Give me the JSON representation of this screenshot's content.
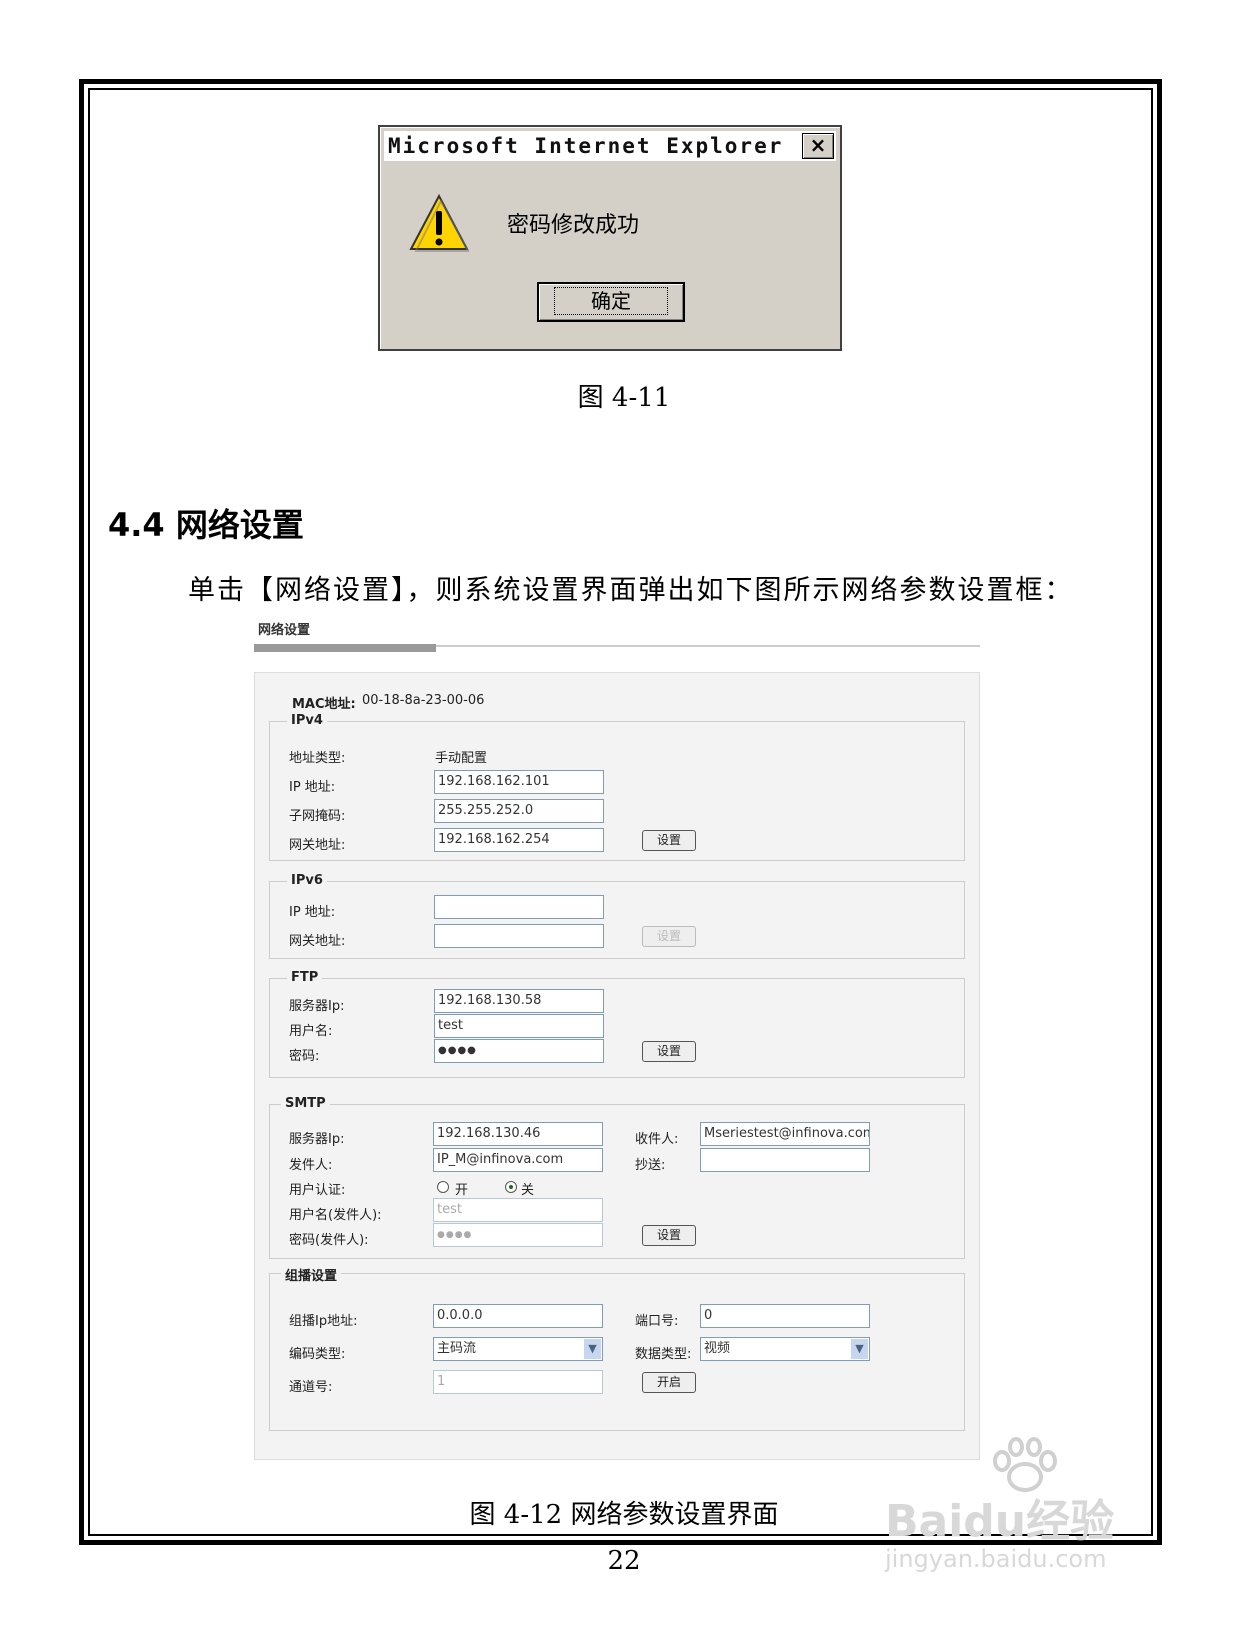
{
  "dialog": {
    "title": "Microsoft Internet Explorer",
    "close": "×",
    "message": "密码修改成功",
    "ok": "确定"
  },
  "fig1": "图 4-11",
  "heading": "4.4  网络设置",
  "intro": "单击【网络设置】，则系统设置界面弹出如下图所示网络参数设置框：",
  "net": {
    "title": "网络设置",
    "mac_label": "MAC地址:",
    "mac_value": "00-18-8a-23-00-06",
    "ipv4": {
      "title": "IPv4",
      "addr_type_label": "地址类型:",
      "addr_type_value": "手动配置",
      "ip_label": "IP 地址:",
      "ip_value": "192.168.162.101",
      "mask_label": "子网掩码:",
      "mask_value": "255.255.252.0",
      "gw_label": "网关地址:",
      "gw_value": "192.168.162.254",
      "set": "设置"
    },
    "ipv6": {
      "title": "IPv6",
      "ip_label": "IP 地址:",
      "ip_value": "",
      "gw_label": "网关地址:",
      "gw_value": "",
      "set": "设置"
    },
    "ftp": {
      "title": "FTP",
      "server_label": "服务器Ip:",
      "server_value": "192.168.130.58",
      "user_label": "用户名:",
      "user_value": "test",
      "pwd_label": "密码:",
      "pwd_value": "●●●●",
      "set": "设置"
    },
    "smtp": {
      "title": "SMTP",
      "server_label": "服务器Ip:",
      "server_value": "192.168.130.46",
      "receiver_label": "收件人:",
      "receiver_value": "Mseriestest@infinova.com",
      "sender_label": "发件人:",
      "sender_value": "IP_M@infinova.com",
      "cc_label": "抄送:",
      "cc_value": "",
      "auth_label": "用户认证:",
      "auth_on": "开",
      "auth_off": "关",
      "user_label": "用户名(发件人):",
      "user_value": "test",
      "pwd_label": "密码(发件人):",
      "pwd_value": "●●●●",
      "set": "设置"
    },
    "multicast": {
      "title": "组播设置",
      "ip_label": "组播Ip地址:",
      "ip_value": "0.0.0.0",
      "port_label": "端口号:",
      "port_value": "0",
      "enc_label": "编码类型:",
      "enc_value": "主码流",
      "data_label": "数据类型:",
      "data_value": "视频",
      "ch_label": "通道号:",
      "ch_value": "1",
      "open": "开启"
    }
  },
  "fig2": "图 4-12  网络参数设置界面",
  "page_number": "22",
  "watermark": {
    "brand": "Baidu经验",
    "url": "jingyan.baidu.com"
  }
}
